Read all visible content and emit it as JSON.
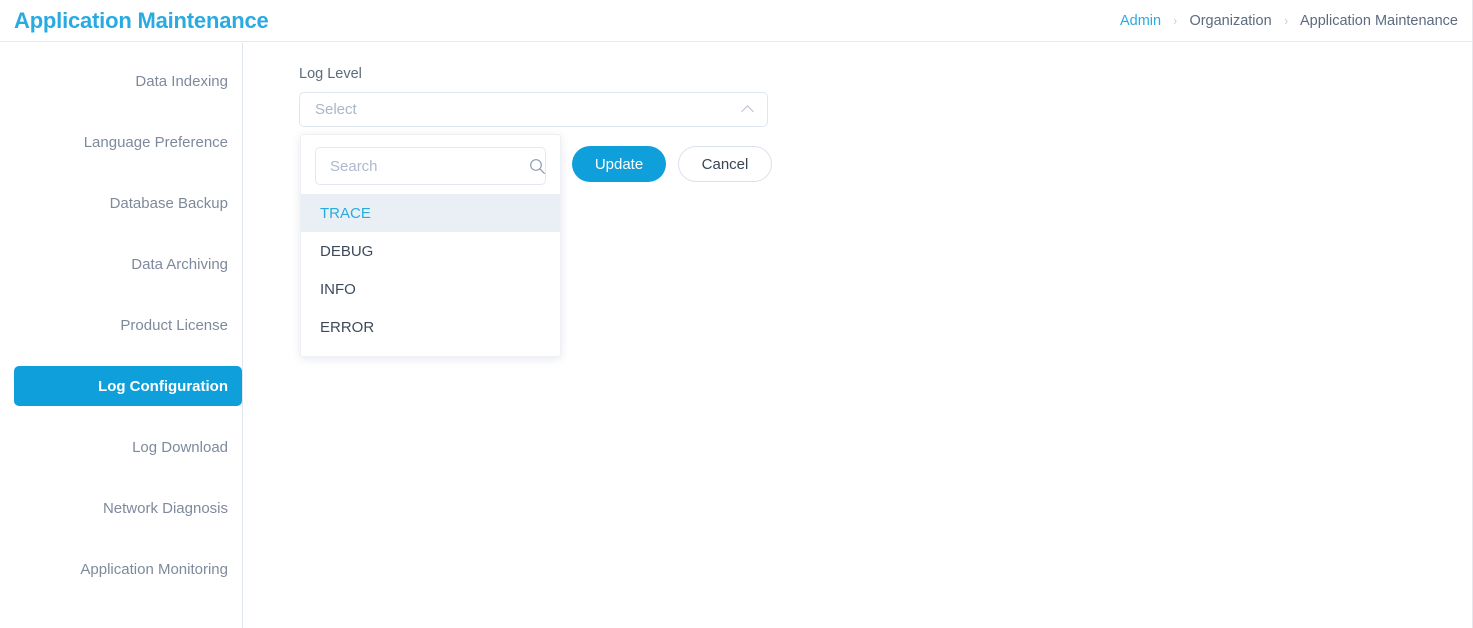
{
  "header": {
    "title": "Application Maintenance",
    "breadcrumb": [
      {
        "label": "Admin",
        "type": "link"
      },
      {
        "label": "Organization",
        "type": "text"
      },
      {
        "label": "Application Maintenance",
        "type": "text"
      }
    ],
    "separator": "›"
  },
  "sidebar": {
    "items": [
      {
        "label": "Data Indexing",
        "active": false
      },
      {
        "label": "Language Preference",
        "active": false
      },
      {
        "label": "Database Backup",
        "active": false
      },
      {
        "label": "Data Archiving",
        "active": false
      },
      {
        "label": "Product License",
        "active": false
      },
      {
        "label": "Log Configuration",
        "active": true
      },
      {
        "label": "Log Download",
        "active": false
      },
      {
        "label": "Network Diagnosis",
        "active": false
      },
      {
        "label": "Application Monitoring",
        "active": false
      }
    ]
  },
  "main": {
    "field_label": "Log Level",
    "select": {
      "value": "",
      "placeholder": "Select",
      "chevron": "chevron-up-icon",
      "expanded": true
    },
    "dropdown": {
      "search": {
        "value": "",
        "placeholder": "Search",
        "icon": "search-icon"
      },
      "options": [
        {
          "label": "TRACE",
          "selected": true
        },
        {
          "label": "DEBUG",
          "selected": false
        },
        {
          "label": "INFO",
          "selected": false
        },
        {
          "label": "ERROR",
          "selected": false
        }
      ]
    },
    "buttons": {
      "update": "Update",
      "cancel": "Cancel"
    }
  },
  "colors": {
    "accent": "#29abe2",
    "primary_button": "#0f9fdb",
    "sidebar_active": "#0f9fdb",
    "text_muted": "#7e8a9c",
    "text_dark": "#3d4a5c",
    "option_selected_bg": "#e9eff4",
    "border": "#e2e6ee"
  }
}
